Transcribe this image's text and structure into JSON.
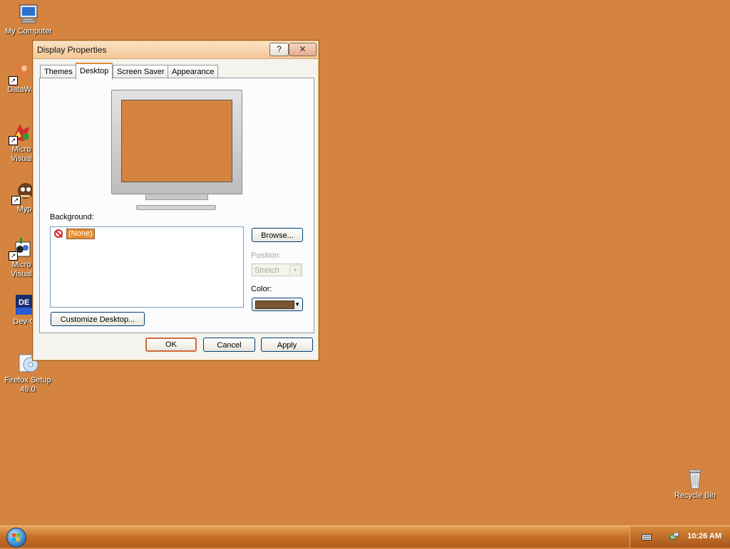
{
  "desktop": {
    "background_color": "#d4843f",
    "icons": [
      {
        "name": "My Computer",
        "icon": "computer-icon"
      },
      {
        "name": "DataWa",
        "icon": "datawarehouse-icon"
      },
      {
        "name": "Micro\nVisual",
        "icon": "visual-studio-icon"
      },
      {
        "name": "Myp",
        "icon": "mypaint-icon"
      },
      {
        "name": "Micro\nVisual",
        "icon": "visual-foxpro-icon"
      },
      {
        "name": "Dev-C",
        "icon": "dev-cpp-icon"
      },
      {
        "name": "Firefox Setup\n48.0",
        "icon": "firefox-setup-icon"
      },
      {
        "name": "Recycle Bin",
        "icon": "recycle-bin-icon"
      }
    ]
  },
  "window": {
    "title": "Display Properties",
    "help_label": "?",
    "close_label": "✕",
    "tabs": [
      {
        "label": "Themes",
        "active": false
      },
      {
        "label": "Desktop",
        "active": true
      },
      {
        "label": "Screen Saver",
        "active": false
      },
      {
        "label": "Appearance",
        "active": false
      }
    ],
    "background_label": "Background:",
    "background_items": [
      {
        "label": "(None)",
        "selected": true,
        "icon": "no-entry-icon"
      }
    ],
    "browse_label": "Browse...",
    "position_label": "Position:",
    "position_value": "Stretch",
    "color_label": "Color:",
    "color_value": "#7a5530",
    "customize_label": "Customize Desktop...",
    "ok_label": "OK",
    "cancel_label": "Cancel",
    "apply_label": "Apply"
  },
  "taskbar": {
    "clock": "10:26 AM",
    "tray_icons": [
      "keyboard-icon",
      "network-icon"
    ]
  }
}
